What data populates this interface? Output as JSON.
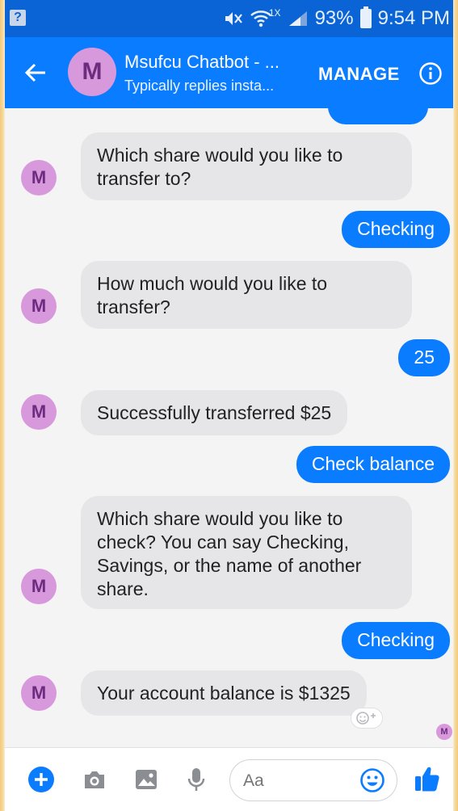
{
  "status_bar": {
    "notification_badge": "?",
    "network_type": "1X",
    "battery": "93%",
    "time": "9:54 PM"
  },
  "header": {
    "avatar_letter": "M",
    "title": "Msufcu Chatbot - ...",
    "subtitle": "Typically replies insta...",
    "manage_label": "MANAGE"
  },
  "messages": [
    {
      "from": "bot",
      "text": "Which share would you like to transfer to?"
    },
    {
      "from": "user",
      "text": "Checking"
    },
    {
      "from": "bot",
      "text": "How much would you like to transfer?"
    },
    {
      "from": "user",
      "text": "25"
    },
    {
      "from": "bot",
      "text": "Successfully transferred $25"
    },
    {
      "from": "user",
      "text": "Check balance"
    },
    {
      "from": "bot",
      "text": "Which share would you like to check? You can say Checking, Savings, or the name of another share."
    },
    {
      "from": "user",
      "text": "Checking"
    },
    {
      "from": "bot",
      "text": "Your account balance is $1325"
    }
  ],
  "bot_avatar_letter": "M",
  "composer": {
    "placeholder": "Aa"
  },
  "colors": {
    "accent": "#0a7cff",
    "status_bar": "#0a64d6",
    "avatar_bg": "#d898dc",
    "avatar_text": "#6e2c7f",
    "incoming_bubble": "#e6e6e8"
  },
  "icons": [
    "back-arrow-icon",
    "info-icon",
    "plus-icon",
    "camera-icon",
    "image-icon",
    "microphone-icon",
    "emoji-icon",
    "thumbs-up-icon",
    "reaction-icon"
  ]
}
